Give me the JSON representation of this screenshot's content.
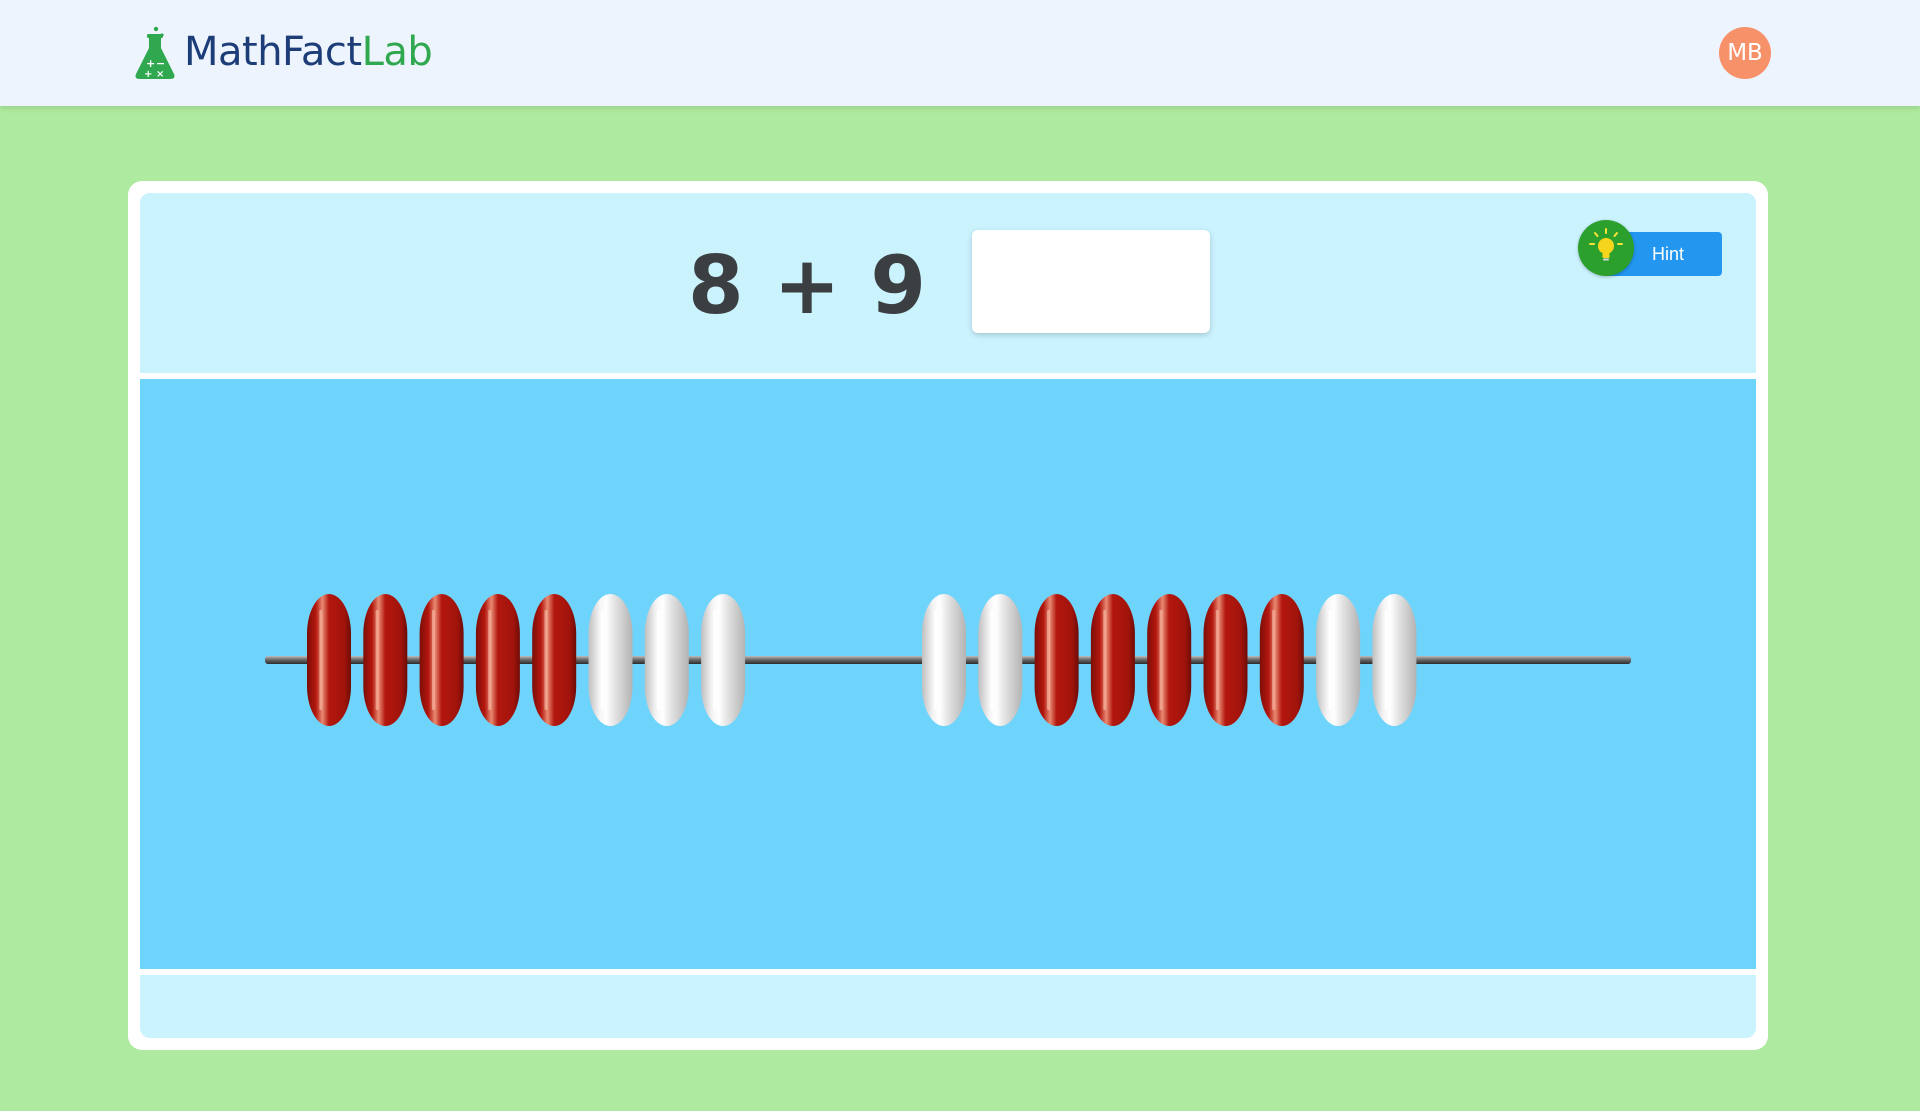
{
  "brand": {
    "name_part1": "MathFact",
    "name_part2": "Lab",
    "icon": "flask-icon",
    "color_primary": "#1c3d78",
    "color_accent": "#2fa84f"
  },
  "user": {
    "initials": "MB",
    "avatar_color": "#f7916a"
  },
  "problem": {
    "expression": "8 + 9",
    "equals": "=",
    "answer": ""
  },
  "hint": {
    "label": "Hint",
    "icon": "lightbulb-icon"
  },
  "abacus": {
    "bead_colors": {
      "red": "#b3170e",
      "white": "#ececec"
    },
    "groups": [
      {
        "beads": [
          "red",
          "red",
          "red",
          "red",
          "red",
          "white",
          "white",
          "white"
        ]
      },
      {
        "beads": [
          "white",
          "white",
          "red",
          "red",
          "red",
          "red",
          "red",
          "white",
          "white"
        ]
      }
    ]
  }
}
